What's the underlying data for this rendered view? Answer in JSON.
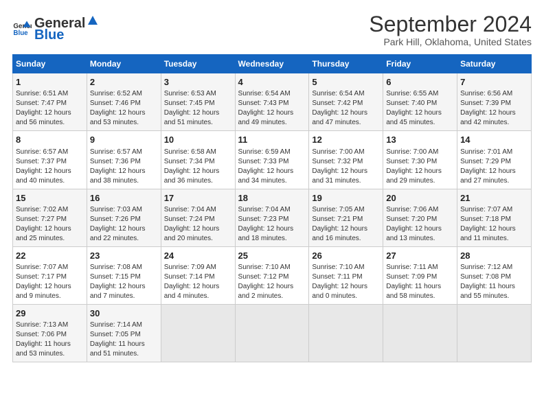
{
  "header": {
    "logo_general": "General",
    "logo_blue": "Blue",
    "title": "September 2024",
    "location": "Park Hill, Oklahoma, United States"
  },
  "weekdays": [
    "Sunday",
    "Monday",
    "Tuesday",
    "Wednesday",
    "Thursday",
    "Friday",
    "Saturday"
  ],
  "weeks": [
    [
      {
        "day": "1",
        "sunrise": "6:51 AM",
        "sunset": "7:47 PM",
        "daylight": "12 hours and 56 minutes."
      },
      {
        "day": "2",
        "sunrise": "6:52 AM",
        "sunset": "7:46 PM",
        "daylight": "12 hours and 53 minutes."
      },
      {
        "day": "3",
        "sunrise": "6:53 AM",
        "sunset": "7:45 PM",
        "daylight": "12 hours and 51 minutes."
      },
      {
        "day": "4",
        "sunrise": "6:54 AM",
        "sunset": "7:43 PM",
        "daylight": "12 hours and 49 minutes."
      },
      {
        "day": "5",
        "sunrise": "6:54 AM",
        "sunset": "7:42 PM",
        "daylight": "12 hours and 47 minutes."
      },
      {
        "day": "6",
        "sunrise": "6:55 AM",
        "sunset": "7:40 PM",
        "daylight": "12 hours and 45 minutes."
      },
      {
        "day": "7",
        "sunrise": "6:56 AM",
        "sunset": "7:39 PM",
        "daylight": "12 hours and 42 minutes."
      }
    ],
    [
      {
        "day": "8",
        "sunrise": "6:57 AM",
        "sunset": "7:37 PM",
        "daylight": "12 hours and 40 minutes."
      },
      {
        "day": "9",
        "sunrise": "6:57 AM",
        "sunset": "7:36 PM",
        "daylight": "12 hours and 38 minutes."
      },
      {
        "day": "10",
        "sunrise": "6:58 AM",
        "sunset": "7:34 PM",
        "daylight": "12 hours and 36 minutes."
      },
      {
        "day": "11",
        "sunrise": "6:59 AM",
        "sunset": "7:33 PM",
        "daylight": "12 hours and 34 minutes."
      },
      {
        "day": "12",
        "sunrise": "7:00 AM",
        "sunset": "7:32 PM",
        "daylight": "12 hours and 31 minutes."
      },
      {
        "day": "13",
        "sunrise": "7:00 AM",
        "sunset": "7:30 PM",
        "daylight": "12 hours and 29 minutes."
      },
      {
        "day": "14",
        "sunrise": "7:01 AM",
        "sunset": "7:29 PM",
        "daylight": "12 hours and 27 minutes."
      }
    ],
    [
      {
        "day": "15",
        "sunrise": "7:02 AM",
        "sunset": "7:27 PM",
        "daylight": "12 hours and 25 minutes."
      },
      {
        "day": "16",
        "sunrise": "7:03 AM",
        "sunset": "7:26 PM",
        "daylight": "12 hours and 22 minutes."
      },
      {
        "day": "17",
        "sunrise": "7:04 AM",
        "sunset": "7:24 PM",
        "daylight": "12 hours and 20 minutes."
      },
      {
        "day": "18",
        "sunrise": "7:04 AM",
        "sunset": "7:23 PM",
        "daylight": "12 hours and 18 minutes."
      },
      {
        "day": "19",
        "sunrise": "7:05 AM",
        "sunset": "7:21 PM",
        "daylight": "12 hours and 16 minutes."
      },
      {
        "day": "20",
        "sunrise": "7:06 AM",
        "sunset": "7:20 PM",
        "daylight": "12 hours and 13 minutes."
      },
      {
        "day": "21",
        "sunrise": "7:07 AM",
        "sunset": "7:18 PM",
        "daylight": "12 hours and 11 minutes."
      }
    ],
    [
      {
        "day": "22",
        "sunrise": "7:07 AM",
        "sunset": "7:17 PM",
        "daylight": "12 hours and 9 minutes."
      },
      {
        "day": "23",
        "sunrise": "7:08 AM",
        "sunset": "7:15 PM",
        "daylight": "12 hours and 7 minutes."
      },
      {
        "day": "24",
        "sunrise": "7:09 AM",
        "sunset": "7:14 PM",
        "daylight": "12 hours and 4 minutes."
      },
      {
        "day": "25",
        "sunrise": "7:10 AM",
        "sunset": "7:12 PM",
        "daylight": "12 hours and 2 minutes."
      },
      {
        "day": "26",
        "sunrise": "7:10 AM",
        "sunset": "7:11 PM",
        "daylight": "12 hours and 0 minutes."
      },
      {
        "day": "27",
        "sunrise": "7:11 AM",
        "sunset": "7:09 PM",
        "daylight": "11 hours and 58 minutes."
      },
      {
        "day": "28",
        "sunrise": "7:12 AM",
        "sunset": "7:08 PM",
        "daylight": "11 hours and 55 minutes."
      }
    ],
    [
      {
        "day": "29",
        "sunrise": "7:13 AM",
        "sunset": "7:06 PM",
        "daylight": "11 hours and 53 minutes."
      },
      {
        "day": "30",
        "sunrise": "7:14 AM",
        "sunset": "7:05 PM",
        "daylight": "11 hours and 51 minutes."
      },
      {
        "day": "",
        "sunrise": "",
        "sunset": "",
        "daylight": ""
      },
      {
        "day": "",
        "sunrise": "",
        "sunset": "",
        "daylight": ""
      },
      {
        "day": "",
        "sunrise": "",
        "sunset": "",
        "daylight": ""
      },
      {
        "day": "",
        "sunrise": "",
        "sunset": "",
        "daylight": ""
      },
      {
        "day": "",
        "sunrise": "",
        "sunset": "",
        "daylight": ""
      }
    ]
  ],
  "labels": {
    "sunrise": "Sunrise:",
    "sunset": "Sunset:",
    "daylight": "Daylight:"
  }
}
